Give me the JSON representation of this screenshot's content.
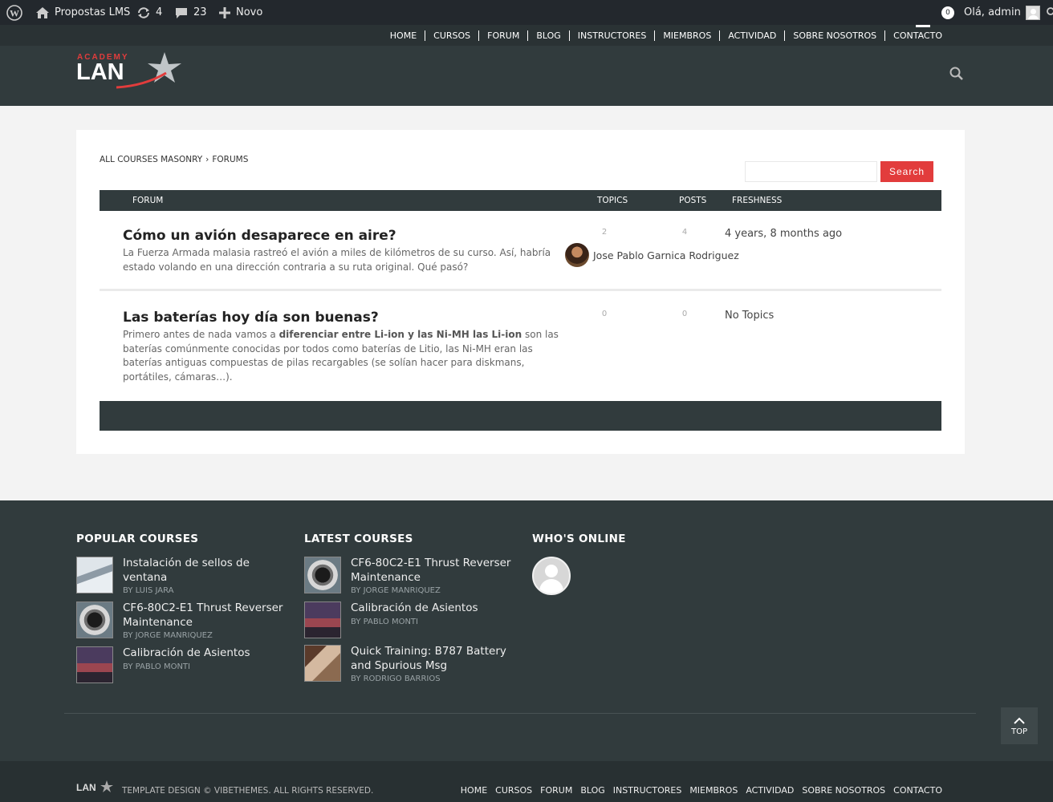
{
  "adminbar": {
    "site_name": "Propostas LMS",
    "updates_count": "4",
    "comments_count": "23",
    "new_label": "Novo",
    "notifications_count": "0",
    "greeting": "Olá, admin"
  },
  "header": {
    "nav": [
      "HOME",
      "CURSOS",
      "FORUM",
      "BLOG",
      "INSTRUCTORES",
      "MIEMBROS",
      "ACTIVIDAD",
      "SOBRE NOSOTROS",
      "CONTACTO"
    ],
    "logo_top": "ACADEMY",
    "logo_main": "LAN"
  },
  "main": {
    "breadcrumb": {
      "root": "ALL COURSES MASONRY",
      "sep": "›",
      "current": "FORUMS"
    },
    "search_button": "Search",
    "columns": {
      "forum": "FORUM",
      "topics": "TOPICS",
      "posts": "POSTS",
      "freshness": "FRESHNESS"
    },
    "forums": [
      {
        "title": "Cómo un avión desaparece en aire?",
        "description": "La Fuerza Armada malasia rastreó el avión a miles de kilómetros de su curso. Así, habría estado volando en una dirección contraria a su ruta original. Qué pasó?",
        "topics": "2",
        "posts": "4",
        "freshness": "4 years, 8 months ago",
        "author": "Jose Pablo Garnica Rodriguez"
      },
      {
        "title": "Las baterías hoy día son buenas?",
        "description_pre": "Primero antes de nada vamos a ",
        "description_bold": "diferenciar entre Li-ion y las Ni-MH las Li-ion",
        "description_post": " son las baterías comúnmente conocidas por todos como baterías de Litio, las Ni-MH eran las baterías antiguas compuestas de pilas recargables (se solían hacer para diskmans, portátiles, cámaras…).",
        "topics": "0",
        "posts": "0",
        "freshness": "No Topics"
      }
    ]
  },
  "footer": {
    "popular": {
      "heading": "POPULAR COURSES",
      "items": [
        {
          "title": "Instalación de sellos de ventana",
          "by": "BY LUIS JARA"
        },
        {
          "title": "CF6-80C2-E1 Thrust Reverser Maintenance",
          "by": "BY JORGE MANRIQUEZ"
        },
        {
          "title": "Calibración de Asientos",
          "by": "BY PABLO MONTI"
        }
      ]
    },
    "latest": {
      "heading": "LATEST COURSES",
      "items": [
        {
          "title": "CF6-80C2-E1 Thrust Reverser Maintenance",
          "by": "BY JORGE MANRIQUEZ"
        },
        {
          "title": "Calibración de Asientos",
          "by": "BY PABLO MONTI"
        },
        {
          "title": "Quick Training: B787 Battery and Spurious Msg",
          "by": "BY RODRIGO BARRIOS"
        }
      ]
    },
    "online": {
      "heading": "WHO'S ONLINE"
    },
    "top_label": "TOP"
  },
  "bottombar": {
    "copyright": "TEMPLATE DESIGN © VIBETHEMES. ALL RIGHTS RESERVED.",
    "nav": [
      "HOME",
      "CURSOS",
      "FORUM",
      "BLOG",
      "INSTRUCTORES",
      "MIEMBROS",
      "ACTIVIDAD",
      "SOBRE NOSOTROS",
      "CONTACTO"
    ]
  },
  "colors": {
    "header_bg": "#313b3d",
    "accent_red": "#e23c3c",
    "admin_bar": "#23282d"
  },
  "icons": [
    "wordpress-icon",
    "home-icon",
    "updates-icon",
    "comments-icon",
    "plus-icon",
    "search-icon",
    "chevron-up-icon"
  ]
}
